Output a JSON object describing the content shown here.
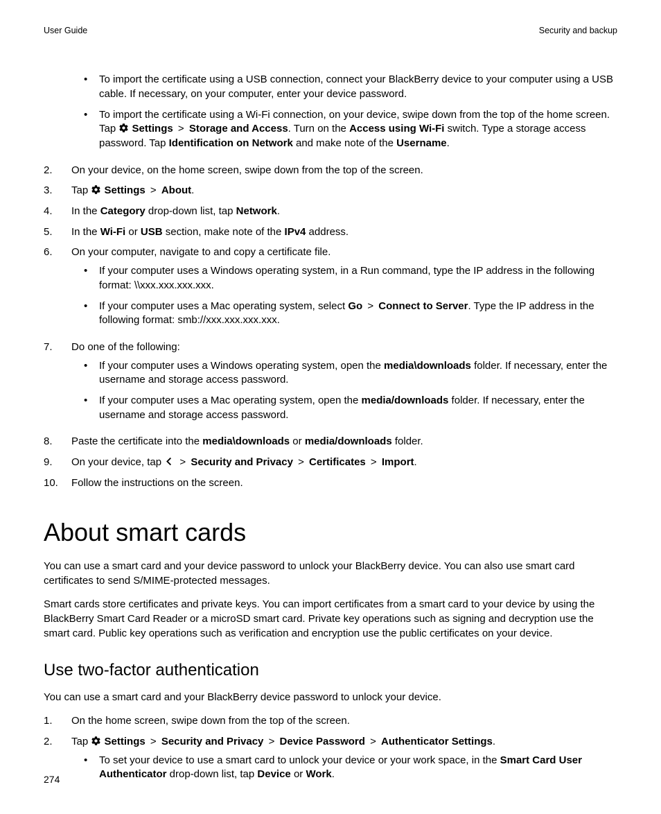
{
  "header": {
    "left": "User Guide",
    "right": "Security and backup"
  },
  "pagenum": "274",
  "steps": {
    "s1_sub1_a": "To import the certificate using a USB connection, connect your BlackBerry device to your computer using a USB cable. If necessary, on your computer, enter your device password.",
    "s1_sub2_lead": "To import the certificate using a Wi-Fi connection, on your device, swipe down from the top of the home screen. Tap ",
    "s1_sub2_settings": "Settings",
    "s1_sub2_storage": "Storage and Access",
    "s1_sub2_turn": ". Turn on the ",
    "s1_sub2_wifi": "Access using Wi-Fi",
    "s1_sub2_switch": " switch. Type a storage access password. Tap ",
    "s1_sub2_ident": "Identification on Network",
    "s1_sub2_note": " and make note of the ",
    "s1_sub2_user": "Username",
    "s1_sub2_end": ".",
    "n2": "2.",
    "s2": "On your device, on the home screen, swipe down from the top of the screen.",
    "n3": "3.",
    "s3_tap": "Tap ",
    "s3_settings": "Settings",
    "s3_about": "About",
    "s3_dot": ".",
    "n4": "4.",
    "s4_a": "In the ",
    "s4_cat": "Category",
    "s4_b": " drop-down list, tap ",
    "s4_net": "Network",
    "s4_c": ".",
    "n5": "5.",
    "s5_a": "In the ",
    "s5_wifi": "Wi-Fi",
    "s5_or": " or ",
    "s5_usb": "USB",
    "s5_b": " section, make note of the ",
    "s5_ipv4": "IPv4",
    "s5_c": " address.",
    "n6": "6.",
    "s6": "On your computer, navigate to and copy a certificate file.",
    "s6_sub1": "If your computer uses a Windows operating system, in a Run command, type the IP address in the following format: \\\\xxx.xxx.xxx.xxx.",
    "s6_sub2_a": "If your computer uses a Mac operating system, select ",
    "s6_sub2_go": "Go",
    "s6_sub2_cts": "Connect to Server",
    "s6_sub2_b": ". Type the IP address in the following format: smb://xxx.xxx.xxx.xxx.",
    "n7": "7.",
    "s7": "Do one of the following:",
    "s7_sub1_a": "If your computer uses a Windows operating system, open the ",
    "s7_sub1_md": "media\\downloads",
    "s7_sub1_b": " folder. If necessary, enter the username and storage access password.",
    "s7_sub2_a": "If your computer uses a Mac operating system, open the ",
    "s7_sub2_md": "media/downloads",
    "s7_sub2_b": " folder. If necessary, enter the username and storage access password.",
    "n8": "8.",
    "s8_a": "Paste the certificate into the ",
    "s8_md1": "media\\downloads",
    "s8_or": " or ",
    "s8_md2": "media/downloads",
    "s8_b": " folder.",
    "n9": "9.",
    "s9_a": "On your device, tap ",
    "s9_sp": "Security and Privacy",
    "s9_cert": "Certificates",
    "s9_imp": "Import",
    "s9_dot": ".",
    "n10": "10.",
    "s10": "Follow the instructions on the screen."
  },
  "gt": " > ",
  "dot": "•",
  "about": {
    "title": "About smart cards",
    "p1": "You can use a smart card and your device password to unlock your BlackBerry device. You can also use smart card certificates to send S/MIME-protected messages.",
    "p2": "Smart cards store certificates and private keys. You can import certificates from a smart card to your device by using the BlackBerry Smart Card Reader or a microSD smart card. Private key operations such as signing and decryption use the smart card. Public key operations such as verification and encryption use the public certificates on your device."
  },
  "twofa": {
    "title": "Use two-factor authentication",
    "p1": "You can use a smart card and your BlackBerry device password to unlock your device.",
    "n1": "1.",
    "s1": "On the home screen, swipe down from the top of the screen.",
    "n2": "2.",
    "s2_tap": "Tap ",
    "s2_settings": "Settings",
    "s2_sp": "Security and Privacy",
    "s2_dp": "Device Password",
    "s2_as": "Authenticator Settings",
    "s2_dot": ".",
    "s2_sub_a": "To set your device to use a smart card to unlock your device or your work space, in the ",
    "s2_sub_scu": "Smart Card User Authenticator",
    "s2_sub_b": " drop-down list, tap ",
    "s2_sub_dev": "Device",
    "s2_sub_or": " or ",
    "s2_sub_work": "Work",
    "s2_sub_c": "."
  }
}
